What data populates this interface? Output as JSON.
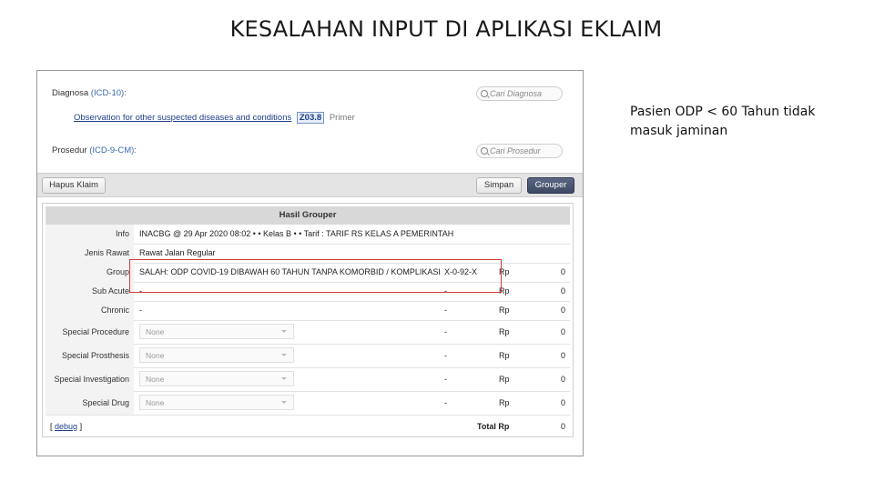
{
  "slide": {
    "title": "KESALAHAN INPUT DI APLIKASI EKLAIM",
    "note": "Pasien ODP < 60 Tahun tidak masuk jaminan"
  },
  "form": {
    "diagnosa_label": "Diagnosa",
    "diagnosa_hint": "(ICD-10):",
    "diagnosa_search_placeholder": "Cari Diagnosa",
    "diagnosis_item": {
      "description": "Observation for other suspected diseases and conditions",
      "code": "Z03.8",
      "type": "Primer"
    },
    "prosedur_label": "Prosedur",
    "prosedur_hint": "(ICD-9-CM):",
    "prosedur_search_placeholder": "Cari Prosedur"
  },
  "toolbar": {
    "hapus_label": "Hapus Klaim",
    "simpan_label": "Simpan",
    "grouper_label": "Grouper"
  },
  "grouper": {
    "header": "Hasil Grouper",
    "rows": {
      "info": {
        "label": "Info",
        "value": "INACBG @ 29 Apr 2020 08:02 • • Kelas B • • Tarif : TARIF RS KELAS A PEMERINTAH"
      },
      "jenis_rawat": {
        "label": "Jenis Rawat",
        "value": "Rawat Jalan Regular"
      },
      "group": {
        "label": "Group",
        "value": "SALAH: ODP COVID-19 DIBAWAH 60 TAHUN TANPA KOMORBID / KOMPLIKASI",
        "code": "X-0-92-X",
        "currency": "Rp",
        "amount": "0"
      },
      "sub_acute": {
        "label": "Sub Acute",
        "value": "-",
        "code": "-",
        "currency": "Rp",
        "amount": "0"
      },
      "chronic": {
        "label": "Chronic",
        "value": "-",
        "code": "-",
        "currency": "Rp",
        "amount": "0"
      },
      "special_procedure": {
        "label": "Special Procedure",
        "selected": "None",
        "code": "-",
        "currency": "Rp",
        "amount": "0"
      },
      "special_prosthesis": {
        "label": "Special Prosthesis",
        "selected": "None",
        "code": "-",
        "currency": "Rp",
        "amount": "0"
      },
      "special_investigation": {
        "label": "Special Investigation",
        "selected": "None",
        "code": "-",
        "currency": "Rp",
        "amount": "0"
      },
      "special_drug": {
        "label": "Special Drug",
        "selected": "None",
        "code": "-",
        "currency": "Rp",
        "amount": "0"
      }
    },
    "footer": {
      "debug_open": "[",
      "debug_label": "debug",
      "debug_close": "]",
      "total_label": "Total Rp",
      "total_amount": "0"
    }
  },
  "colors": {
    "highlight": "#d33a3a",
    "primary_button": "#46526c",
    "link": "#1f3f8a"
  }
}
